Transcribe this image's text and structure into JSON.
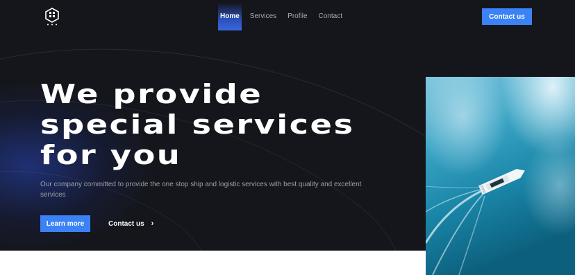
{
  "brand": {
    "logo_icon": "hexagon-logo-icon"
  },
  "nav": {
    "items": [
      {
        "label": "Home",
        "active": true
      },
      {
        "label": "Services",
        "active": false
      },
      {
        "label": "Profile",
        "active": false
      },
      {
        "label": "Contact",
        "active": false
      }
    ],
    "cta_label": "Contact us"
  },
  "hero": {
    "headline_lines": [
      "We provide",
      "special services",
      "for you"
    ],
    "subtitle": "Our company committed to provide the one stop ship and logistic services with best quality and excellent services",
    "primary_button": "Learn more",
    "secondary_button": "Contact us",
    "secondary_icon": "chevron-right-icon",
    "image_icon": "ship-aerial-photo"
  },
  "colors": {
    "background": "#15161b",
    "accent": "#3b82f6",
    "text_muted": "#9c9faa"
  }
}
